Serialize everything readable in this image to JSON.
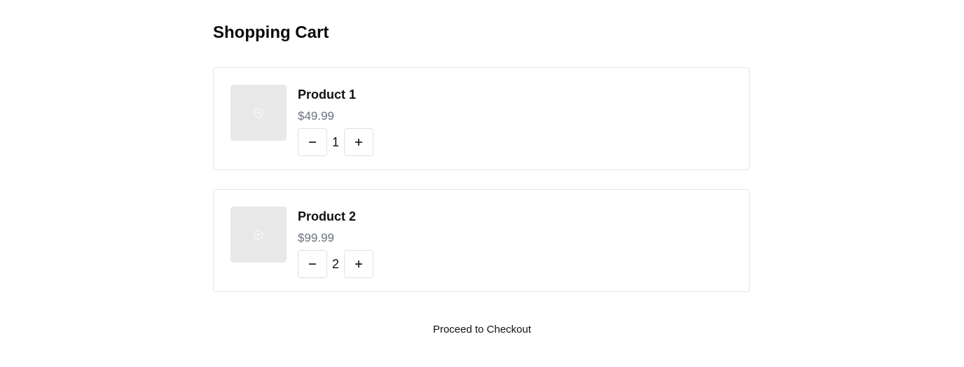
{
  "page": {
    "title": "Shopping Cart"
  },
  "cart": {
    "items": [
      {
        "name": "Product 1",
        "price": "$49.99",
        "quantity": "1",
        "image_icon": "image-placeholder-icon"
      },
      {
        "name": "Product 2",
        "price": "$99.99",
        "quantity": "2",
        "image_icon": "image-placeholder-icon"
      }
    ],
    "controls": {
      "decrement_icon": "minus-icon",
      "increment_icon": "plus-icon"
    }
  },
  "checkout": {
    "label": "Proceed to Checkout"
  },
  "colors": {
    "price_text": "#6b7280",
    "card_border": "#e5e5e5",
    "thumbnail_bg": "#e8e8e8"
  }
}
